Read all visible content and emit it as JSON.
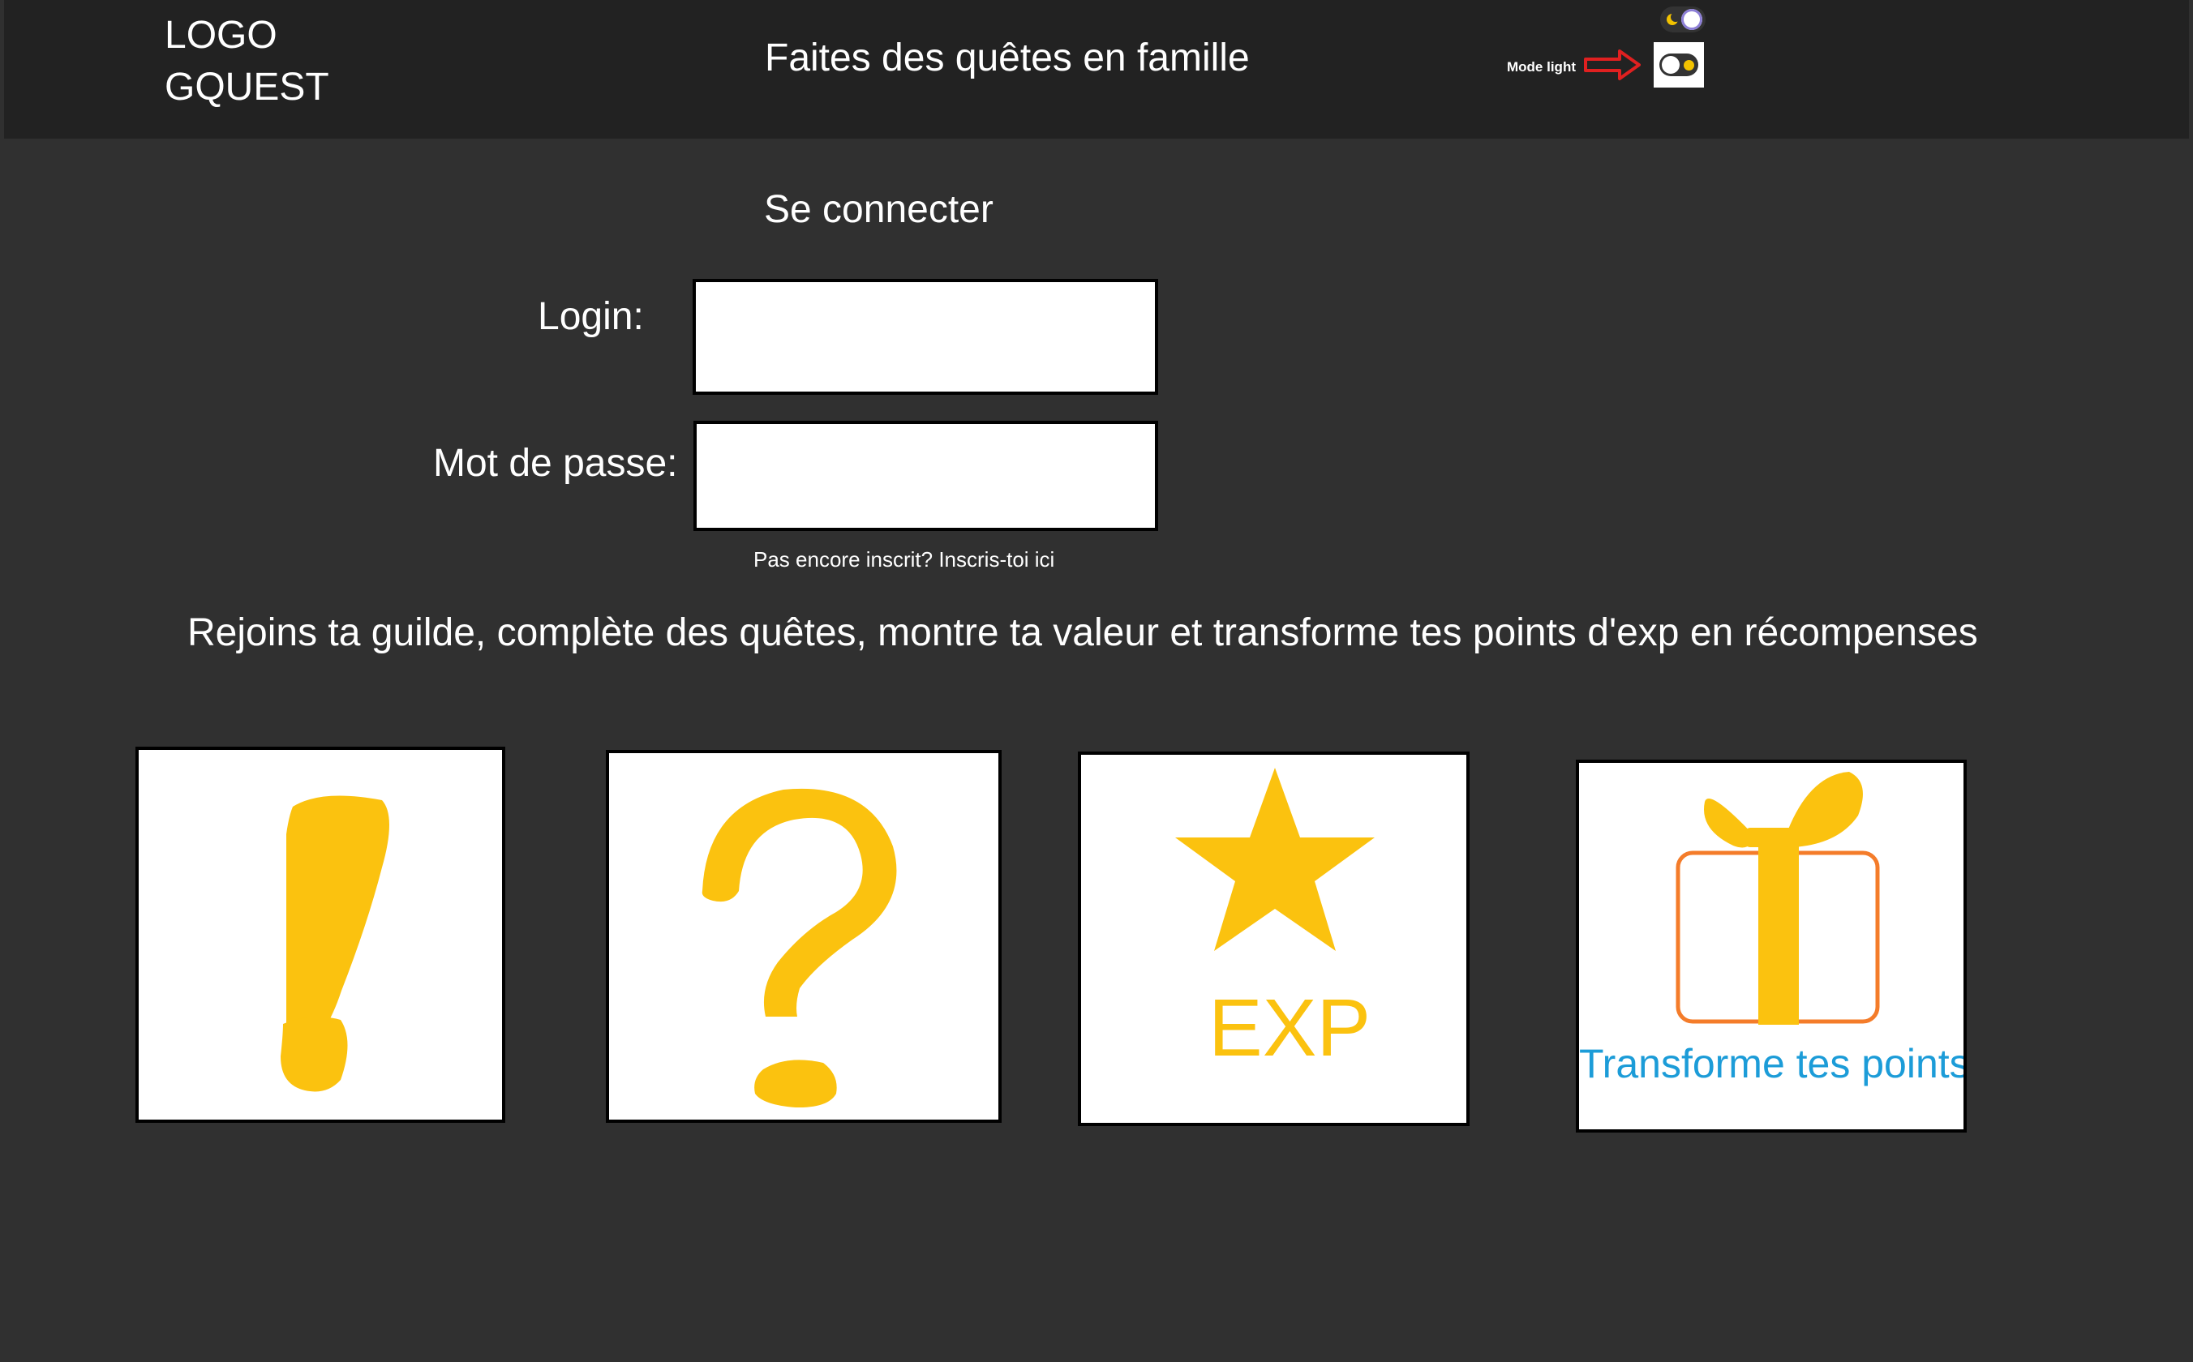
{
  "header": {
    "logo_line1": "LOGO",
    "logo_line2": "GQUEST",
    "tagline": "Faites des quêtes en famille",
    "mode_label": "Mode light"
  },
  "login": {
    "title": "Se connecter",
    "login_label": "Login:",
    "login_value": "",
    "password_label": "Mot de passe:",
    "password_value": "",
    "signup_link": "Pas encore inscrit? Inscris-toi ici"
  },
  "intro": "Rejoins ta guilde, complète des quêtes, montre ta valeur et transforme tes points d'exp en récompenses",
  "cards": [
    {
      "icon": "exclamation-icon"
    },
    {
      "icon": "question-icon"
    },
    {
      "icon": "star-icon",
      "label": "EXP"
    },
    {
      "icon": "gift-icon",
      "label": "Transforme tes points"
    }
  ],
  "colors": {
    "background": "#303030",
    "header": "#222222",
    "yellow": "#fbc20f",
    "blue": "#1c9cd8",
    "orange": "#f47c2a",
    "arrow_red": "#e02020"
  }
}
